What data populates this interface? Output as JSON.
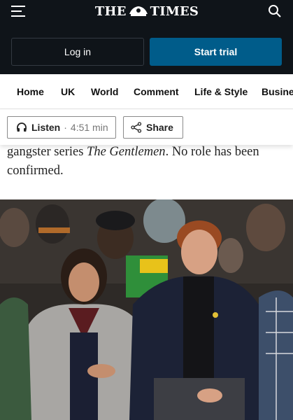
{
  "header": {
    "logo_text_left": "THE",
    "logo_text_right": "TIMES",
    "login_label": "Log in",
    "trial_label": "Start trial",
    "icons": [
      "menu-icon",
      "crest-icon",
      "search-icon"
    ]
  },
  "nav": {
    "items": [
      {
        "label": "Home"
      },
      {
        "label": "UK"
      },
      {
        "label": "World"
      },
      {
        "label": "Comment"
      },
      {
        "label": "Life & Style"
      },
      {
        "label": "Business"
      }
    ]
  },
  "actions": {
    "listen_label": "Listen",
    "listen_duration": "4:51 min",
    "share_label": "Share",
    "icons": [
      "headphones-icon",
      "share-icon"
    ]
  },
  "article": {
    "text_before": "gangster series ",
    "text_italic": "The Gentlemen",
    "text_after": ". No role has been confirmed."
  },
  "colors": {
    "header_bg": "#0f1419",
    "trial_button": "#005c8a",
    "text": "#111111"
  }
}
